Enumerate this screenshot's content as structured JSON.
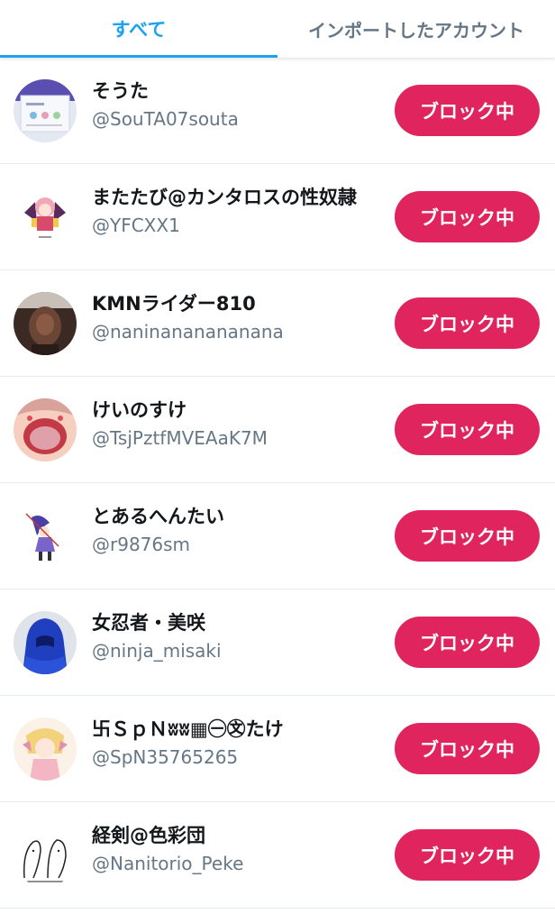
{
  "tabs": [
    {
      "label": "すべて",
      "active": true
    },
    {
      "label": "インポートしたアカウント",
      "active": false
    }
  ],
  "block_button_label": "ブロック中",
  "accent_color": "#1da1f2",
  "block_color": "#e0245e",
  "users": [
    {
      "name": "そうた",
      "handle": "@SouTA07souta"
    },
    {
      "name": "またたび@カンタロスの性奴隷",
      "handle": "@YFCXX1"
    },
    {
      "name": "KMNライダー810",
      "handle": "@naninananananana"
    },
    {
      "name": "けいのすけ",
      "handle": "@TsjPztfMVEAaK7M"
    },
    {
      "name": "とあるへんたい",
      "handle": "@r9876sm"
    },
    {
      "name": "女忍者・美咲",
      "handle": "@ninja_misaki"
    },
    {
      "name": "卐ＳｐＮʬʬ▦㊀㉆たけ",
      "handle": "@SpN35765265"
    },
    {
      "name": "経剣@色彩団",
      "handle": "@Nanitorio_Peke"
    }
  ]
}
